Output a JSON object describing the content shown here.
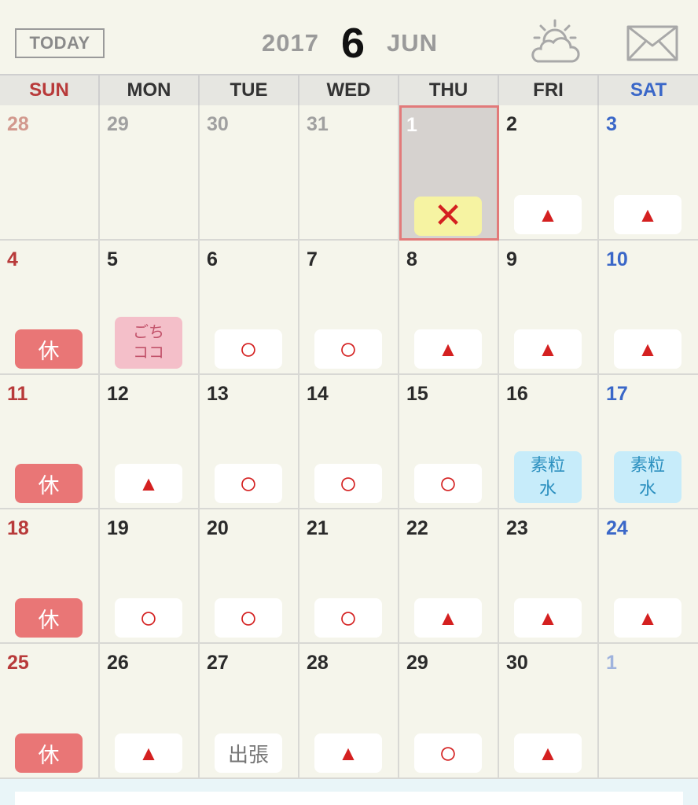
{
  "header": {
    "today_label": "TODAY",
    "year": "2017",
    "month_number": "6",
    "month_name": "JUN",
    "icons": [
      "weather-icon",
      "mail-icon"
    ]
  },
  "weekdays": [
    "SUN",
    "MON",
    "TUE",
    "WED",
    "THU",
    "FRI",
    "SAT"
  ],
  "colors": {
    "sunday": "#b83a3a",
    "saturday": "#3a67c8",
    "mark_red": "#d42020",
    "holiday_badge": "#e97676",
    "today_border": "#e27a7a"
  },
  "days": [
    {
      "date": "28",
      "other": true,
      "mark": ""
    },
    {
      "date": "29",
      "other": true,
      "mark": ""
    },
    {
      "date": "30",
      "other": true,
      "mark": ""
    },
    {
      "date": "31",
      "other": true,
      "mark": ""
    },
    {
      "date": "1",
      "today": true,
      "mark": "x"
    },
    {
      "date": "2",
      "mark": "triangle"
    },
    {
      "date": "3",
      "mark": "triangle"
    },
    {
      "date": "4",
      "mark": "text-red",
      "text": "休"
    },
    {
      "date": "5",
      "mark": "text-pink",
      "text": "ごち\nココ"
    },
    {
      "date": "6",
      "mark": "circle"
    },
    {
      "date": "7",
      "mark": "circle"
    },
    {
      "date": "8",
      "mark": "triangle"
    },
    {
      "date": "9",
      "mark": "triangle"
    },
    {
      "date": "10",
      "mark": "triangle"
    },
    {
      "date": "11",
      "mark": "text-red",
      "text": "休"
    },
    {
      "date": "12",
      "mark": "triangle"
    },
    {
      "date": "13",
      "mark": "circle"
    },
    {
      "date": "14",
      "mark": "circle"
    },
    {
      "date": "15",
      "mark": "circle"
    },
    {
      "date": "16",
      "mark": "text-blue",
      "text": "素粒\n水"
    },
    {
      "date": "17",
      "mark": "text-blue",
      "text": "素粒\n水"
    },
    {
      "date": "18",
      "mark": "text-red",
      "text": "休"
    },
    {
      "date": "19",
      "mark": "circle"
    },
    {
      "date": "20",
      "mark": "circle"
    },
    {
      "date": "21",
      "mark": "circle"
    },
    {
      "date": "22",
      "mark": "triangle"
    },
    {
      "date": "23",
      "mark": "triangle"
    },
    {
      "date": "24",
      "mark": "triangle"
    },
    {
      "date": "25",
      "mark": "text-red",
      "text": "休"
    },
    {
      "date": "26",
      "mark": "triangle"
    },
    {
      "date": "27",
      "mark": "text-gray",
      "text": "出張"
    },
    {
      "date": "28",
      "mark": "triangle"
    },
    {
      "date": "29",
      "mark": "circle"
    },
    {
      "date": "30",
      "mark": "triangle"
    },
    {
      "date": "1",
      "other": true,
      "mark": ""
    }
  ]
}
